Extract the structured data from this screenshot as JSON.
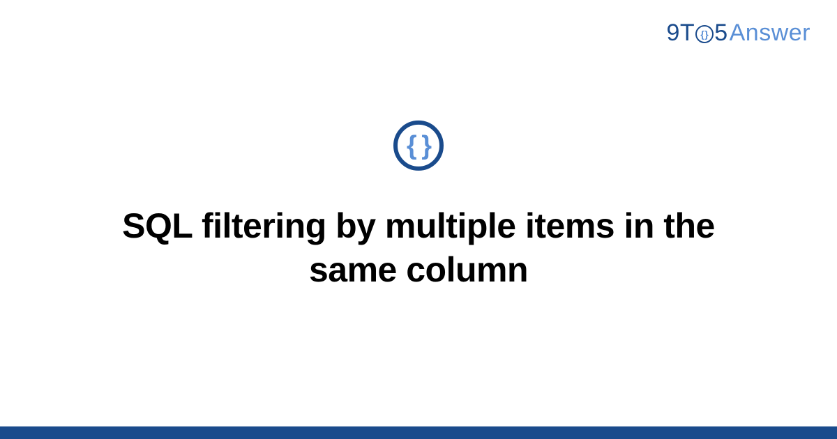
{
  "logo": {
    "part1": "9T",
    "part_o": "{}",
    "part2": "5",
    "part3": "Answer"
  },
  "icon": {
    "braces": "{ }"
  },
  "title": "SQL filtering by multiple items in the same column",
  "colors": {
    "primary": "#1a4b8c",
    "accent": "#5a8fd6"
  }
}
